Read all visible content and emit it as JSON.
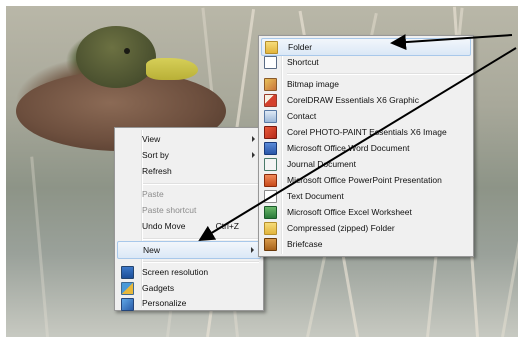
{
  "context_menu": {
    "items": [
      {
        "label": "View",
        "has_submenu": true
      },
      {
        "label": "Sort by",
        "has_submenu": true
      },
      {
        "label": "Refresh"
      },
      {
        "label": "Paste",
        "disabled": true
      },
      {
        "label": "Paste shortcut",
        "disabled": true
      },
      {
        "label": "Undo Move",
        "shortcut": "Ctrl+Z"
      },
      {
        "label": "New",
        "has_submenu": true,
        "highlighted": true
      },
      {
        "label": "Screen resolution",
        "icon": "screen-resolution-icon"
      },
      {
        "label": "Gadgets",
        "icon": "gadgets-icon"
      },
      {
        "label": "Personalize",
        "icon": "personalize-icon"
      }
    ]
  },
  "new_submenu": {
    "items": [
      {
        "label": "Folder",
        "icon": "folder-icon",
        "highlighted": true
      },
      {
        "label": "Shortcut",
        "icon": "shortcut-icon"
      },
      {
        "label": "Bitmap image",
        "icon": "bitmap-image-icon"
      },
      {
        "label": "CorelDRAW Essentials X6 Graphic",
        "icon": "coreldraw-icon"
      },
      {
        "label": "Contact",
        "icon": "contact-icon"
      },
      {
        "label": "Corel PHOTO-PAINT Essentials X6 Image",
        "icon": "photo-paint-icon"
      },
      {
        "label": "Microsoft Office Word Document",
        "icon": "word-icon"
      },
      {
        "label": "Journal Document",
        "icon": "journal-icon"
      },
      {
        "label": "Microsoft Office PowerPoint Presentation",
        "icon": "powerpoint-icon"
      },
      {
        "label": "Text Document",
        "icon": "text-document-icon"
      },
      {
        "label": "Microsoft Office Excel Worksheet",
        "icon": "excel-icon"
      },
      {
        "label": "Compressed (zipped) Folder",
        "icon": "zip-folder-icon"
      },
      {
        "label": "Briefcase",
        "icon": "briefcase-icon"
      }
    ]
  },
  "colors": {
    "menu_background": "#f0f0f0",
    "highlight": "#dbe8f6",
    "annotation_arrow": "#000000"
  }
}
